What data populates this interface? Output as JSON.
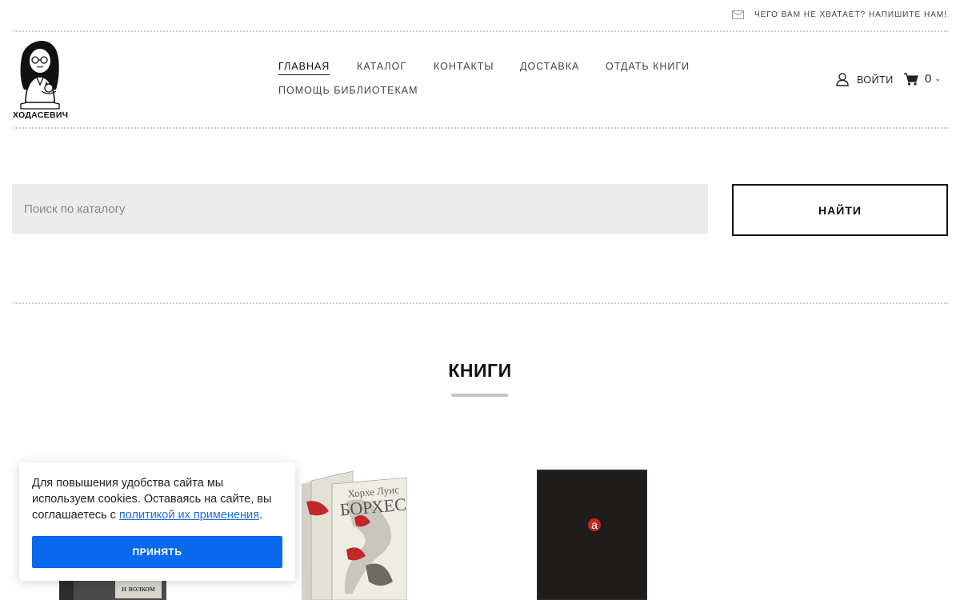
{
  "topbar": {
    "contact_text": "ЧЕГО ВАМ НЕ ХВАТАЕТ? НАПИШИТЕ НАМ!"
  },
  "header": {
    "logo_text": "ХОДАСЕВИЧ",
    "nav": [
      {
        "label": "ГЛАВНАЯ",
        "active": true
      },
      {
        "label": "КАТАЛОГ"
      },
      {
        "label": "КОНТАКТЫ"
      },
      {
        "label": "ДОСТАВКА"
      },
      {
        "label": "ОТДАТЬ КНИГИ"
      },
      {
        "label": "ПОМОЩЬ БИБЛИОТЕКАМ"
      }
    ],
    "login_label": "ВОЙТИ",
    "cart_count": "0"
  },
  "search": {
    "placeholder": "Поиск по каталогу",
    "button_label": "НАЙТИ"
  },
  "section": {
    "title": "КНИГИ"
  },
  "books": [
    {
      "cover_text": "собакой\nи волком"
    },
    {
      "cover_text_top": "Хорхе Луис",
      "cover_text_main": "БОРХЕС"
    },
    {
      "cover_text": "а"
    }
  ],
  "cookie": {
    "text_before": "Для повышения удобства сайта мы используем cookies. Оставаясь на сайте, вы соглашаетесь с ",
    "link_text": "политикой их применения",
    "text_after": ".",
    "accept_label": "ПРИНЯТЬ"
  },
  "colors": {
    "accent_button": "#0a69ec",
    "link": "#1b6fd6",
    "search_bg": "#ebebeb"
  }
}
